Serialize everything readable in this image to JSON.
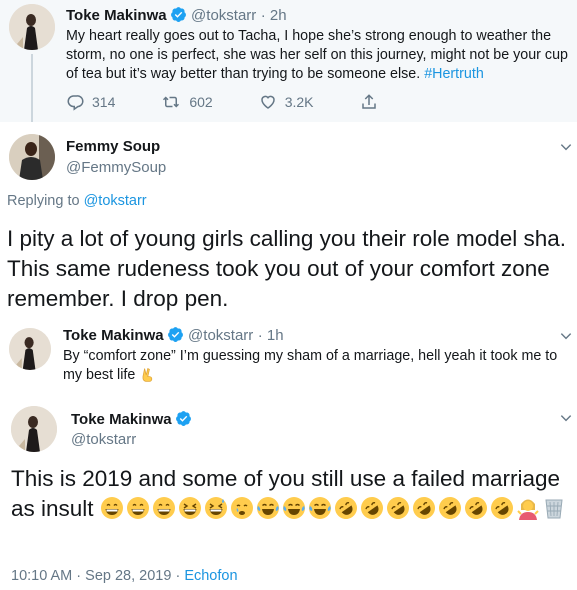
{
  "tweet1": {
    "name": "Toke Makinwa",
    "handle": "@tokstarr",
    "time": "· 2h",
    "text": "My heart really goes out to Tacha, I hope she’s strong enough to weather the storm, no one is perfect, she was her self on this journey, might not be your cup of tea but it’s way better than trying to be someone else.",
    "hashtag": "#Hertruth",
    "replies": "314",
    "retweets": "602",
    "likes": "3.2K"
  },
  "tweet2": {
    "name": "Femmy Soup",
    "handle": "@FemmySoup",
    "replying_label": "Replying to",
    "replying_to": "@tokstarr",
    "text": "I pity a lot of young girls calling you their role model sha. This same rudeness took you out of your comfort zone remember. I drop pen."
  },
  "tweet3": {
    "name": "Toke Makinwa",
    "handle": "@tokstarr",
    "time": "· 1h",
    "text": "By “comfort zone” I’m guessing my sham of a marriage, hell yeah it took me to my best life"
  },
  "tweet4": {
    "name": "Toke Makinwa",
    "handle": "@tokstarr",
    "text": "This is 2019 and some of you  still use a failed marriage as insult",
    "timestamp": "10:10 AM · Sep 28, 2019 ·",
    "source": "Echofon"
  },
  "icons": [
    "verified-icon",
    "chevron-down-icon",
    "reply-icon",
    "retweet-icon",
    "like-icon",
    "share-icon",
    "grinning-emoji",
    "sweat-laugh-emoji",
    "crying-emoji",
    "tears-of-joy-emoji",
    "rofl-emoji",
    "shrugging-woman-emoji",
    "wastebasket-emoji",
    "victory-hand-emoji"
  ],
  "colors": {
    "link": "#1b95e0",
    "secondary": "#657786",
    "thread_line": "#ccd6dd",
    "verified": "#1da1f2",
    "emoji_yellow": "#ffcc4d"
  }
}
